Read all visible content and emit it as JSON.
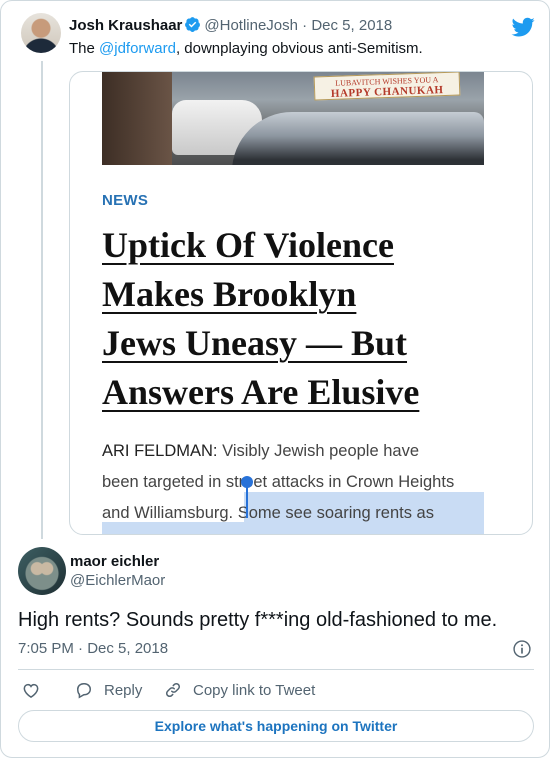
{
  "parent_tweet": {
    "author_name": "Josh Kraushaar",
    "author_handle": "@HotlineJosh",
    "separator": " · ",
    "date": "Dec 5, 2018",
    "text_before": "The ",
    "mention": "@jdforward",
    "text_after": ", downplaying obvious anti-Semitism."
  },
  "media": {
    "sign_line1": "LUBAVITCH WISHES YOU A",
    "sign_line2": "HAPPY CHANUKAH",
    "section": "NEWS",
    "headline_lines": [
      "Uptick Of Violence",
      "Makes Brooklyn",
      "Jews Uneasy — But",
      "Answers Are Elusive"
    ],
    "body": {
      "author": "ARI FELDMAN: ",
      "line1": "Visibly Jewish people have",
      "line2": "been targeted in street attacks in Crown Heights",
      "line3_a": "and Williamsburg. ",
      "line3_b": "Some see soaring rents as"
    }
  },
  "reply_tweet": {
    "author_name": "maor eichler",
    "author_handle": "@EichlerMaor",
    "text": "High rents? Sounds pretty f***ing old-fashioned to me.",
    "timestamp": "7:05 PM · Dec 5, 2018"
  },
  "actions": {
    "reply_label": "Reply",
    "copy_label": "Copy link to Tweet"
  },
  "explore_label": "Explore what's happening on Twitter",
  "colors": {
    "accent": "#1d9bf0",
    "news_blue": "#2872b4",
    "highlight": "#c9dcf4"
  }
}
